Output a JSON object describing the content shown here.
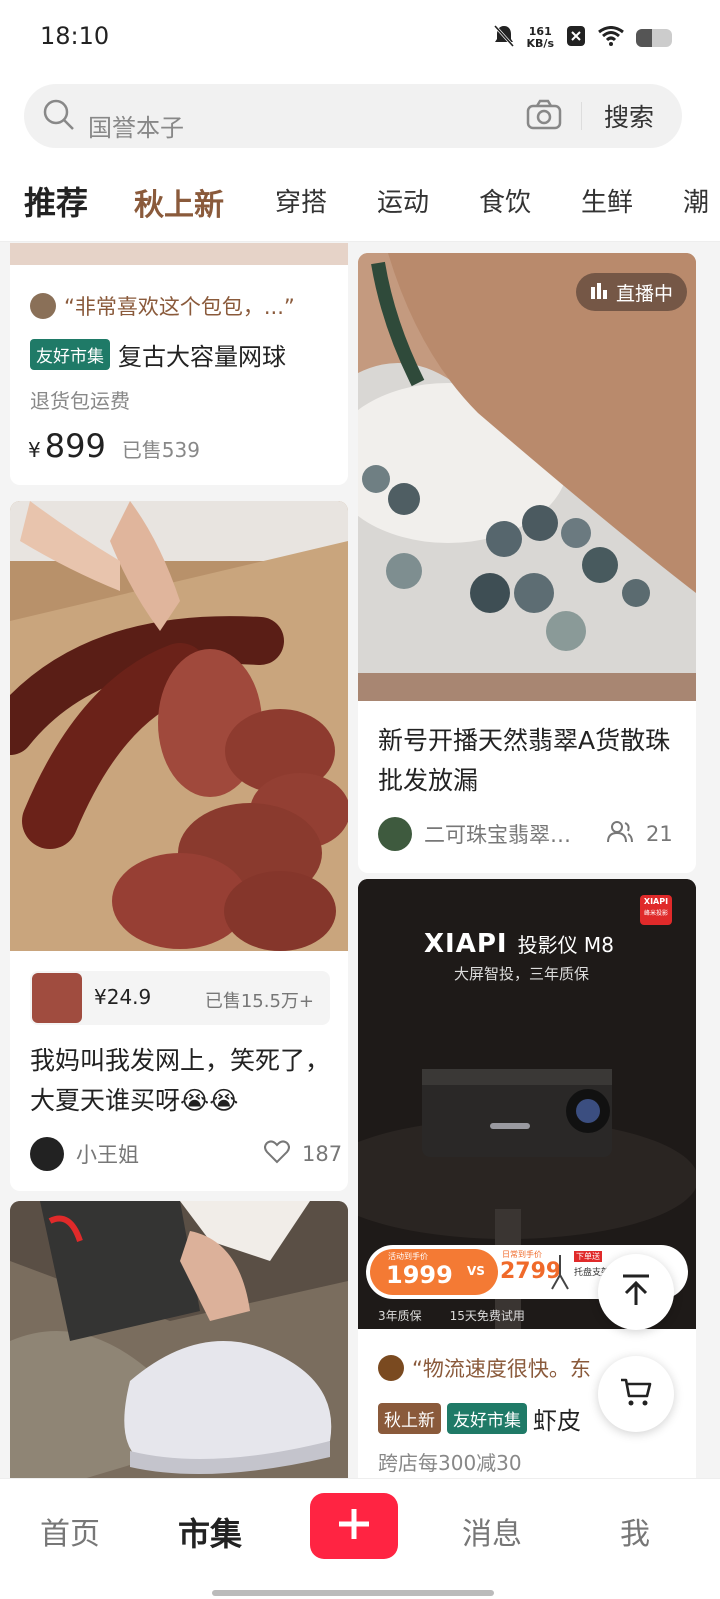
{
  "status": {
    "time": "18:10",
    "net_speed_value": "161",
    "net_speed_unit": "KB/s",
    "battery_level": 0.45
  },
  "search": {
    "text": "国誉本子",
    "button": "搜索"
  },
  "tabs": [
    {
      "label": "推荐"
    },
    {
      "label": "秋上新"
    },
    {
      "label": "穿搭"
    },
    {
      "label": "运动"
    },
    {
      "label": "食饮"
    },
    {
      "label": "生鲜"
    },
    {
      "label": "潮"
    }
  ],
  "feed": {
    "card1": {
      "quote": "“非常喜欢这个包包，...”",
      "tag": "友好市集",
      "title": "复古大容量网球",
      "subtitle": "退货包运费",
      "currency": "¥",
      "price": "899",
      "sold": "已售539"
    },
    "card2": {
      "live_badge": "直播中",
      "title": "新号开播天然翡翠A货散珠批发放漏",
      "author": "二可珠宝翡翠…",
      "viewers": "21"
    },
    "card3": {
      "price": "¥24.9",
      "sold": "已售15.5万+",
      "title": "我妈叫我发网上，笑死了，大夏天谁买呀😭😭",
      "author": "小王姐",
      "likes": "187"
    },
    "card4": {
      "brand": "XIAPI",
      "brand_suffix": "投影仪 M8",
      "tagline": "大屏智投，三年质保",
      "logo_top": "XIAPI",
      "logo_bottom": "峰米投影",
      "promo_label": "活动到手价",
      "promo_price": "1999",
      "vs": "VS",
      "daily_label": "日常到手价",
      "daily_price": "2799",
      "stand_label": "下单送",
      "stand_text": "托盘支架",
      "perks": [
        "3年质保",
        "15天免费试用"
      ],
      "quote": "“物流速度很快。东",
      "tags": [
        "秋上新",
        "友好市集"
      ],
      "title": "虾皮",
      "subtitle": "跨店每300减30"
    }
  },
  "nav": {
    "items": [
      "首页",
      "市集",
      "消息",
      "我"
    ]
  },
  "colors": {
    "accent": "#ff2442",
    "tab_active": "#8a5a3b",
    "tag_green": "#1f7a67",
    "tag_brown": "#8a5a3b"
  }
}
